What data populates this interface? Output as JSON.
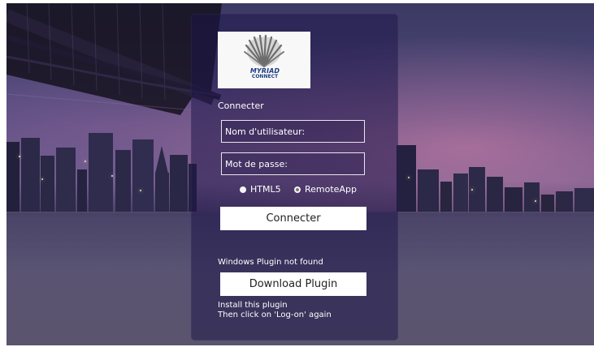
{
  "login": {
    "logo": {
      "title": "MYRIAD",
      "subtitle": "CONNECT"
    },
    "section_title": "Connecter",
    "username": {
      "placeholder": "Nom d'utilisateur:",
      "value": ""
    },
    "password": {
      "placeholder": "Mot de passe:",
      "value": ""
    },
    "modes": {
      "html5": "HTML5",
      "remoteapp": "RemoteApp",
      "selected": "RemoteApp"
    },
    "connect_label": "Connecter",
    "plugin_status": "Windows Plugin not found",
    "download_label": "Download Plugin",
    "install_line_1": "Install this plugin",
    "install_line_2": "Then click on 'Log-on' again"
  },
  "theme": {
    "panel_color": "#1c1548",
    "button_color": "#ffffff",
    "logo_text_color": "#1e3c82"
  },
  "icons": {
    "logo": "shell-logo-icon",
    "radio_unselected": "radio-unselected-icon",
    "radio_selected": "radio-selected-icon"
  }
}
